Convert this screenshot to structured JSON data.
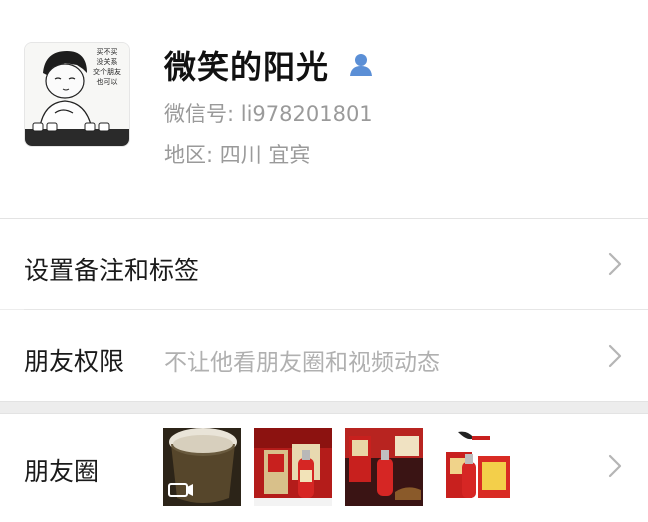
{
  "profile": {
    "name": "微笑的阳光",
    "wechat_id": "微信号: li978201801",
    "region": "地区: 四川  宜宾",
    "avatar_text": "买不买\n没关系\n交个朋友\n也可以"
  },
  "menu": {
    "remark_label": "设置备注和标签",
    "permissions_label": "朋友权限",
    "permissions_value": "不让他看朋友圈和视频动态",
    "moments_label": "朋友圈"
  },
  "icons": {
    "person": "person-icon",
    "chevron": "chevron-right-icon",
    "video": "video-camera-icon"
  },
  "colors": {
    "accent": "#5b8fd6",
    "wine_red": "#c8201e",
    "chevron": "#b5b5b5"
  }
}
